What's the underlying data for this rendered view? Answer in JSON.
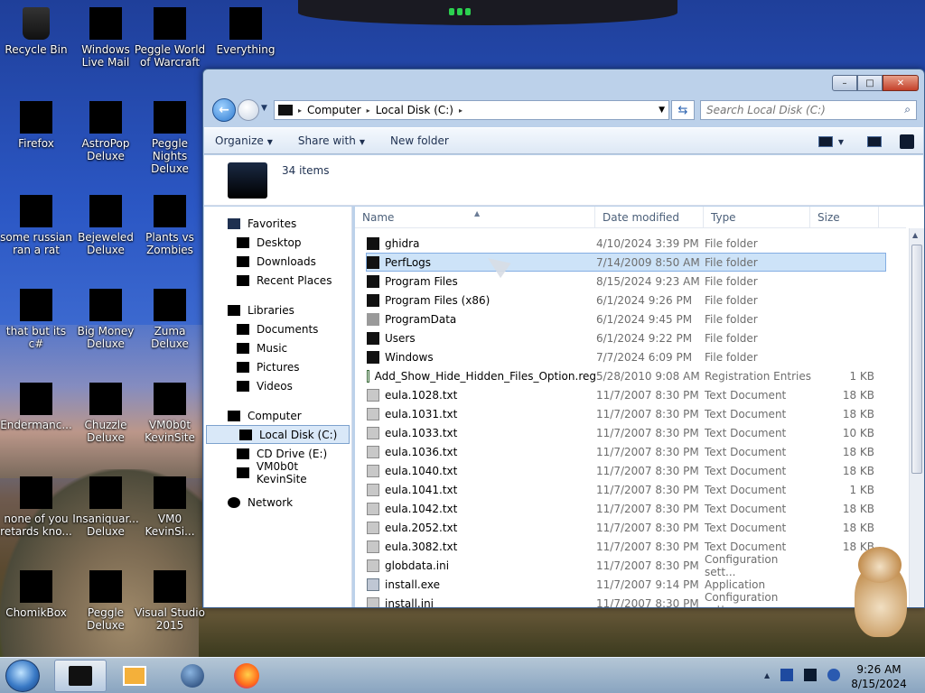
{
  "desktop": {
    "icons": [
      {
        "label": "Recycle Bin",
        "icon": "recycle-bin-icon"
      },
      {
        "label": "Windows Live Mail",
        "icon": "mail-icon"
      },
      {
        "label": "Peggle World of Warcraft",
        "icon": "game-icon"
      },
      {
        "label": "Everything",
        "icon": "search-app-icon"
      },
      {
        "label": "Firefox",
        "icon": "firefox-icon"
      },
      {
        "label": "AstroPop Deluxe",
        "icon": "game-icon"
      },
      {
        "label": "Peggle Nights Deluxe",
        "icon": "game-icon"
      },
      {
        "label": "some russian ran a rat",
        "icon": "app-icon"
      },
      {
        "label": "Bejeweled Deluxe",
        "icon": "game-icon"
      },
      {
        "label": "Plants vs Zombies",
        "icon": "game-icon"
      },
      {
        "label": "that but its c#",
        "icon": "app-icon"
      },
      {
        "label": "Big Money Deluxe",
        "icon": "game-icon"
      },
      {
        "label": "Zuma Deluxe",
        "icon": "game-icon"
      },
      {
        "label": "Endermanc...",
        "icon": "app-icon"
      },
      {
        "label": "Chuzzle Deluxe",
        "icon": "game-icon"
      },
      {
        "label": "VM0b0t KevinSite",
        "icon": "app-icon"
      },
      {
        "label": "none of you retards kno...",
        "icon": "app-icon"
      },
      {
        "label": "Insaniquar... Deluxe",
        "icon": "game-icon"
      },
      {
        "label": "VM0 KevinSi...",
        "icon": "app-icon"
      },
      {
        "label": "ChomikBox",
        "icon": "app-icon"
      },
      {
        "label": "Peggle Deluxe",
        "icon": "game-icon"
      },
      {
        "label": "Visual Studio 2015",
        "icon": "visual-studio-icon"
      }
    ]
  },
  "explorer": {
    "window_controls": {
      "minimize": "–",
      "maximize": "□",
      "close": "✕"
    },
    "nav": {
      "back": "←"
    },
    "breadcrumbs": [
      "Computer",
      "Local Disk (C:)"
    ],
    "crumb_sep": "▸",
    "search": {
      "placeholder": "Search Local Disk (C:)"
    },
    "toolbar": {
      "organize": "Organize",
      "share_with": "Share with",
      "new_folder": "New folder"
    },
    "details": {
      "item_count": "34 items"
    },
    "nav_pane": {
      "favorites": "Favorites",
      "favorites_items": [
        "Desktop",
        "Downloads",
        "Recent Places"
      ],
      "libraries": "Libraries",
      "libraries_items": [
        "Documents",
        "Music",
        "Pictures",
        "Videos"
      ],
      "computer": "Computer",
      "computer_items": [
        "Local Disk (C:)",
        "CD Drive (E:)",
        "VM0b0t KevinSite"
      ],
      "network": "Network"
    },
    "columns": {
      "name": "Name",
      "date": "Date modified",
      "type": "Type",
      "size": "Size"
    },
    "files": [
      {
        "name": "ghidra",
        "date": "4/10/2024 3:39 PM",
        "type": "File folder",
        "size": "",
        "icon": "folder"
      },
      {
        "name": "PerfLogs",
        "date": "7/14/2009 8:50 AM",
        "type": "File folder",
        "size": "",
        "icon": "folder",
        "selected": true
      },
      {
        "name": "Program Files",
        "date": "8/15/2024 9:23 AM",
        "type": "File folder",
        "size": "",
        "icon": "folder"
      },
      {
        "name": "Program Files (x86)",
        "date": "6/1/2024 9:26 PM",
        "type": "File folder",
        "size": "",
        "icon": "folder"
      },
      {
        "name": "ProgramData",
        "date": "6/1/2024 9:45 PM",
        "type": "File folder",
        "size": "",
        "icon": "folder-light"
      },
      {
        "name": "Users",
        "date": "6/1/2024 9:22 PM",
        "type": "File folder",
        "size": "",
        "icon": "folder"
      },
      {
        "name": "Windows",
        "date": "7/7/2024 6:09 PM",
        "type": "File folder",
        "size": "",
        "icon": "folder"
      },
      {
        "name": "Add_Show_Hide_Hidden_Files_Option.reg",
        "date": "5/28/2010 9:08 AM",
        "type": "Registration Entries",
        "size": "1 KB",
        "icon": "reg"
      },
      {
        "name": "eula.1028.txt",
        "date": "11/7/2007 8:30 PM",
        "type": "Text Document",
        "size": "18 KB",
        "icon": "doc"
      },
      {
        "name": "eula.1031.txt",
        "date": "11/7/2007 8:30 PM",
        "type": "Text Document",
        "size": "18 KB",
        "icon": "doc"
      },
      {
        "name": "eula.1033.txt",
        "date": "11/7/2007 8:30 PM",
        "type": "Text Document",
        "size": "10 KB",
        "icon": "doc"
      },
      {
        "name": "eula.1036.txt",
        "date": "11/7/2007 8:30 PM",
        "type": "Text Document",
        "size": "18 KB",
        "icon": "doc"
      },
      {
        "name": "eula.1040.txt",
        "date": "11/7/2007 8:30 PM",
        "type": "Text Document",
        "size": "18 KB",
        "icon": "doc"
      },
      {
        "name": "eula.1041.txt",
        "date": "11/7/2007 8:30 PM",
        "type": "Text Document",
        "size": "1 KB",
        "icon": "doc"
      },
      {
        "name": "eula.1042.txt",
        "date": "11/7/2007 8:30 PM",
        "type": "Text Document",
        "size": "18 KB",
        "icon": "doc"
      },
      {
        "name": "eula.2052.txt",
        "date": "11/7/2007 8:30 PM",
        "type": "Text Document",
        "size": "18 KB",
        "icon": "doc"
      },
      {
        "name": "eula.3082.txt",
        "date": "11/7/2007 8:30 PM",
        "type": "Text Document",
        "size": "18 KB",
        "icon": "doc"
      },
      {
        "name": "globdata.ini",
        "date": "11/7/2007 8:30 PM",
        "type": "Configuration sett...",
        "size": "",
        "icon": "doc"
      },
      {
        "name": "install.exe",
        "date": "11/7/2007 9:14 PM",
        "type": "Application",
        "size": "",
        "icon": "exe"
      },
      {
        "name": "install.ini",
        "date": "11/7/2007 8:30 PM",
        "type": "Configuration sett...",
        "size": "",
        "icon": "doc"
      }
    ]
  },
  "taskbar": {
    "clock_time": "9:26 AM",
    "clock_date": "8/15/2024",
    "tray_arrow": "▲"
  }
}
